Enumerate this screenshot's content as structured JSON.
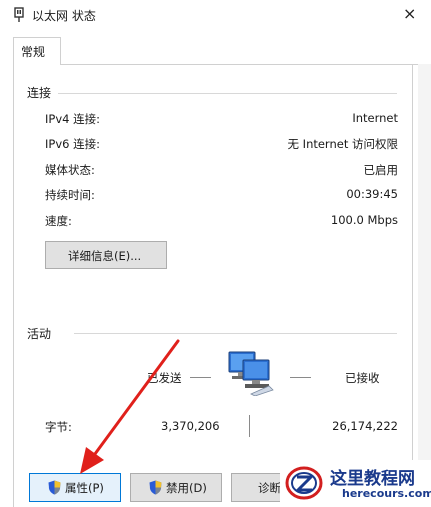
{
  "window": {
    "title": "以太网 状态",
    "close_icon": "×"
  },
  "tabs": [
    {
      "label": "常规"
    }
  ],
  "connection": {
    "section_label": "连接",
    "rows": [
      {
        "label": "IPv4 连接:",
        "value": "Internet"
      },
      {
        "label": "IPv6 连接:",
        "value": "无 Internet 访问权限"
      },
      {
        "label": "媒体状态:",
        "value": "已启用"
      },
      {
        "label": "持续时间:",
        "value": "00:39:45"
      },
      {
        "label": "速度:",
        "value": "100.0 Mbps"
      }
    ],
    "details_button": "详细信息(E)..."
  },
  "activity": {
    "section_label": "活动",
    "sent_label": "已发送",
    "received_label": "已接收",
    "bytes_label": "字节:",
    "bytes_sent": "3,370,206",
    "bytes_received": "26,174,222",
    "network_icon": "network-computers-icon"
  },
  "buttons": {
    "properties": "属性(P)",
    "disable": "禁用(D)",
    "diagnose": "诊断("
  },
  "watermark": {
    "name_cn": "这里教程网",
    "url": "herecours.com"
  },
  "colors": {
    "accent": "#0078d7",
    "arrow": "#e0201b",
    "watermark": "#1a3a8c"
  }
}
